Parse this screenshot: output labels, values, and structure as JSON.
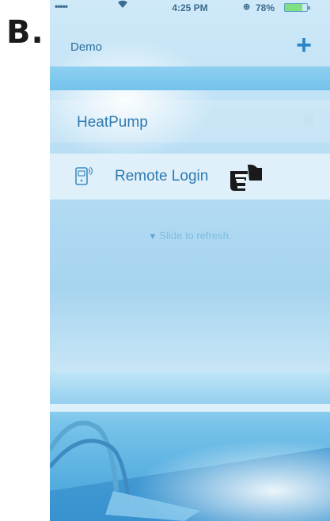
{
  "figure_label": "B.",
  "status_bar": {
    "carrier": "•••••",
    "time": "4:25 PM",
    "battery_percent": "78%",
    "battery_level": 0.78
  },
  "nav": {
    "title": "Demo",
    "add_label": "+"
  },
  "devices": [
    {
      "label": "HeatPump"
    }
  ],
  "remote": {
    "label": "Remote Login"
  },
  "refresh_hint": "Slide to refresh.",
  "icons": {
    "wifi": "wifi-icon",
    "alarm": "alarm-icon",
    "battery": "battery-icon",
    "add": "plus-icon",
    "trash": "trash-icon",
    "remote": "phone-remote-icon",
    "pointer": "pointing-hand-icon",
    "refresh": "down-arrow-icon"
  },
  "colors": {
    "accent": "#2b87c7",
    "text_blue": "#2f79b0",
    "band": "#74c2ec"
  }
}
